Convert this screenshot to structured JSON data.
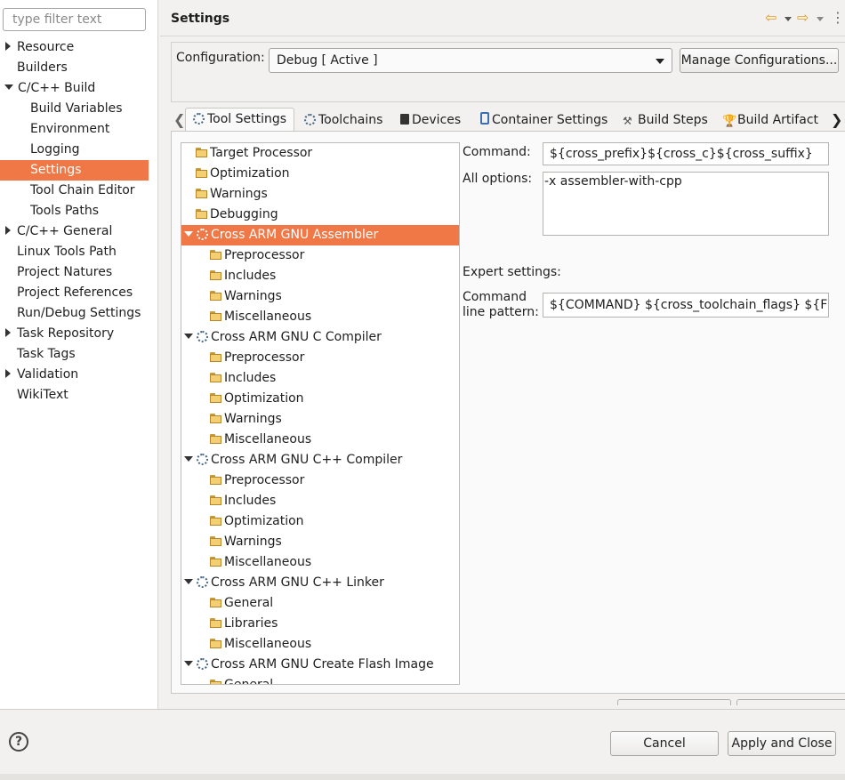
{
  "left_nav": {
    "filter_placeholder": "type filter text",
    "items": [
      {
        "label": "Resource"
      },
      {
        "label": "Builders"
      },
      {
        "label": "C/C++ Build"
      },
      {
        "label": "Build Variables"
      },
      {
        "label": "Environment"
      },
      {
        "label": "Logging"
      },
      {
        "label": "Settings"
      },
      {
        "label": "Tool Chain Editor"
      },
      {
        "label": "Tools Paths"
      },
      {
        "label": "C/C++ General"
      },
      {
        "label": "Linux Tools Path"
      },
      {
        "label": "Project Natures"
      },
      {
        "label": "Project References"
      },
      {
        "label": "Run/Debug Settings"
      },
      {
        "label": "Task Repository"
      },
      {
        "label": "Task Tags"
      },
      {
        "label": "Validation"
      },
      {
        "label": "WikiText"
      }
    ]
  },
  "header": {
    "title": "Settings"
  },
  "configuration": {
    "label": "Configuration:",
    "selected": "Debug  [ Active ]",
    "manage_label": "Manage Configurations..."
  },
  "tabs": [
    {
      "label": "Tool Settings"
    },
    {
      "label": "Toolchains"
    },
    {
      "label": "Devices"
    },
    {
      "label": "Container Settings"
    },
    {
      "label": "Build Steps"
    },
    {
      "label": "Build Artifact"
    }
  ],
  "tree": [
    {
      "label": "Target Processor"
    },
    {
      "label": "Optimization"
    },
    {
      "label": "Warnings"
    },
    {
      "label": "Debugging"
    },
    {
      "label": "Cross ARM GNU Assembler"
    },
    {
      "label": "Preprocessor"
    },
    {
      "label": "Includes"
    },
    {
      "label": "Warnings"
    },
    {
      "label": "Miscellaneous"
    },
    {
      "label": "Cross ARM GNU C Compiler"
    },
    {
      "label": "Preprocessor"
    },
    {
      "label": "Includes"
    },
    {
      "label": "Optimization"
    },
    {
      "label": "Warnings"
    },
    {
      "label": "Miscellaneous"
    },
    {
      "label": "Cross ARM GNU C++ Compiler"
    },
    {
      "label": "Preprocessor"
    },
    {
      "label": "Includes"
    },
    {
      "label": "Optimization"
    },
    {
      "label": "Warnings"
    },
    {
      "label": "Miscellaneous"
    },
    {
      "label": "Cross ARM GNU C++ Linker"
    },
    {
      "label": "General"
    },
    {
      "label": "Libraries"
    },
    {
      "label": "Miscellaneous"
    },
    {
      "label": "Cross ARM GNU Create Flash Image"
    },
    {
      "label": "General"
    }
  ],
  "settings": {
    "command_label": "Command:",
    "command_value": "${cross_prefix}${cross_c}${cross_suffix}",
    "all_options_label": "All options:",
    "all_options_value": "-x assembler-with-cpp",
    "expert_label": "Expert settings:",
    "pattern_label_1": "Command",
    "pattern_label_2": "line pattern:",
    "pattern_value": "${COMMAND} ${cross_toolchain_flags} ${FLAGS}"
  },
  "footer": {
    "cancel_label": "Cancel",
    "apply_label": "Apply and Close",
    "help_glyph": "?"
  },
  "colors": {
    "selection": "#f07746"
  }
}
